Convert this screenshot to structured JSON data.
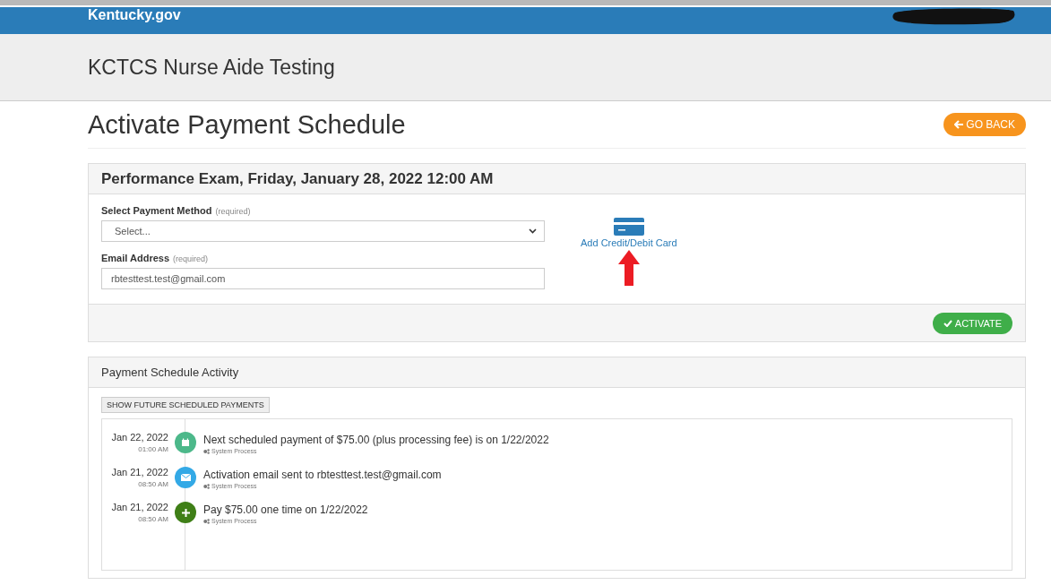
{
  "top_bar": {
    "brand": "Kentucky.gov"
  },
  "site_header": {
    "title": "KCTCS Nurse Aide Testing"
  },
  "page": {
    "title": "Activate Payment Schedule",
    "back_button": "GO BACK"
  },
  "payment_panel": {
    "heading": "Performance Exam, Friday, January 28, 2022 12:00 AM",
    "method_label": "Select Payment Method",
    "method_hint": "(required)",
    "method_value": "Select...",
    "email_label": "Email Address",
    "email_hint": "(required)",
    "email_value": "rbtesttest.test@gmail.com",
    "add_card_link": "Add Credit/Debit Card",
    "activate_button": "ACTIVATE"
  },
  "activity_panel": {
    "heading": "Payment Schedule Activity",
    "show_future_button": "SHOW FUTURE SCHEDULED PAYMENTS",
    "items": [
      {
        "date": "Jan 22, 2022",
        "time": "01:00 AM",
        "kind": "calendar",
        "color": "#4cb88a",
        "text": "Next scheduled payment of $75.00 (plus processing fee) is on 1/22/2022",
        "source": "System Process"
      },
      {
        "date": "Jan 21, 2022",
        "time": "08:50 AM",
        "kind": "mail",
        "color": "#33a9e6",
        "text": "Activation email sent to rbtesttest.test@gmail.com",
        "source": "System Process"
      },
      {
        "date": "Jan 21, 2022",
        "time": "08:50 AM",
        "kind": "plus",
        "color": "#3f7f17",
        "text": "Pay $75.00 one time on 1/22/2022",
        "source": "System Process"
      }
    ]
  }
}
